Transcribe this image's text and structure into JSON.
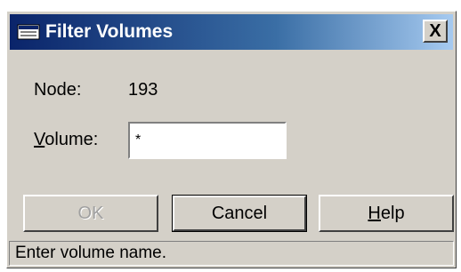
{
  "window": {
    "title": "Filter Volumes",
    "icon": "window-icon",
    "close_label": "X"
  },
  "form": {
    "node_label": "Node:",
    "node_value": "193",
    "volume_label_accel": "V",
    "volume_label_rest": "olume:",
    "volume_value": "*"
  },
  "buttons": {
    "ok": "OK",
    "cancel": "Cancel",
    "help_accel": "H",
    "help_rest": "elp"
  },
  "status": {
    "text": "Enter volume name."
  }
}
